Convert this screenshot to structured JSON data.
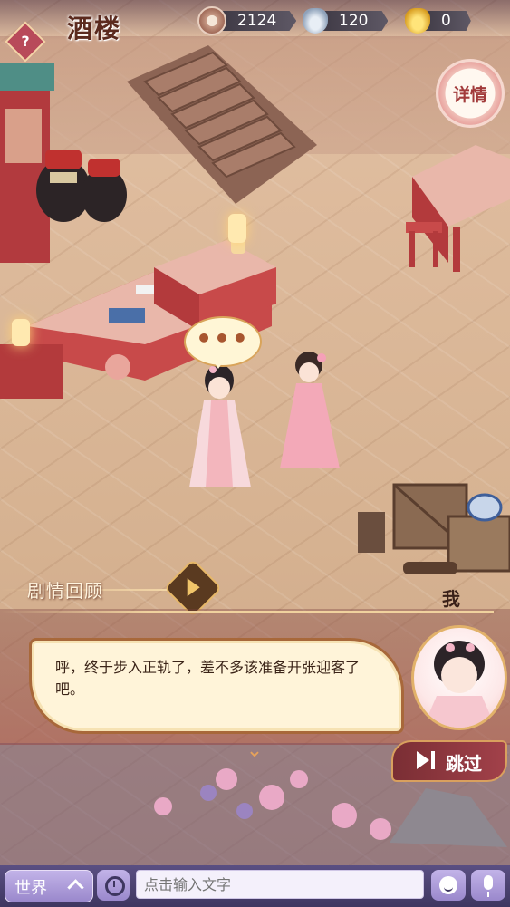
{
  "header": {
    "title": "酒楼",
    "help_icon": "question-mark-icon",
    "resources": [
      {
        "name": "copper-coin-icon",
        "value": "2124"
      },
      {
        "name": "silver-ingot-icon",
        "value": "120"
      },
      {
        "name": "gold-ingot-icon",
        "value": "0"
      }
    ]
  },
  "side": {
    "detail_label": "详情"
  },
  "scene": {
    "bubble_text": "•••"
  },
  "review": {
    "label": "剧情回顾"
  },
  "dialogue": {
    "speaker": "我",
    "text": "呼，终于步入正轨了，差不多该准备开张迎客了吧。",
    "skip_label": "跳过"
  },
  "chat": {
    "channel_label": "世界",
    "input_placeholder": "点击输入文字",
    "history_icon": "history-icon",
    "emoji_icon": "emoji-icon",
    "voice_icon": "microphone-icon"
  },
  "colors": {
    "accent": "#a8683a",
    "title": "#5b2a1e",
    "chatbar": "#4b4270"
  }
}
